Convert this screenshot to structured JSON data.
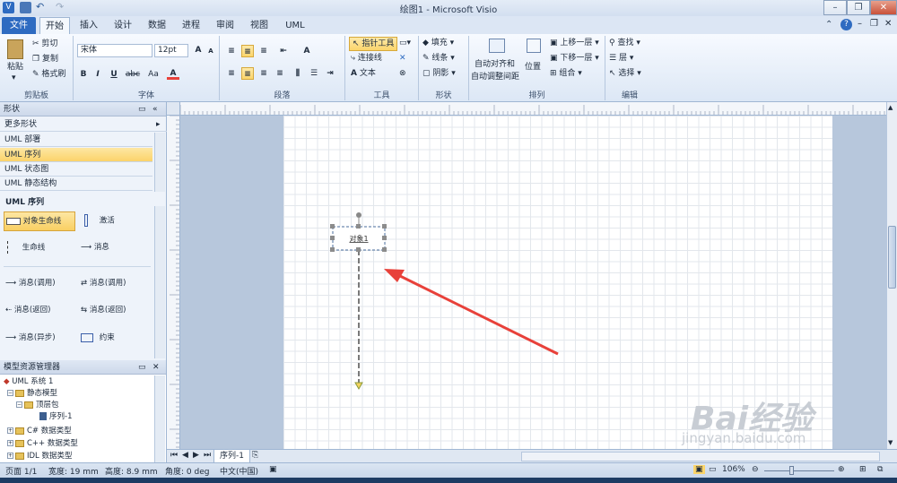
{
  "window": {
    "title": "绘图1 - Microsoft Visio"
  },
  "ribbon_tabs": [
    "文件",
    "开始",
    "插入",
    "设计",
    "数据",
    "进程",
    "审阅",
    "视图",
    "UML"
  ],
  "clipboard": {
    "paste": "粘贴",
    "cut": "剪切",
    "copy": "复制",
    "format_painter": "格式刷",
    "label": "剪贴板"
  },
  "font": {
    "family": "宋体",
    "size": "12pt",
    "label": "字体",
    "bold": "B",
    "italic": "I",
    "underline": "U",
    "strike": "abc",
    "case": "Aa",
    "color": "A"
  },
  "paragraph": {
    "label": "段落"
  },
  "tools": {
    "pointer": "指针工具",
    "connector": "连接线",
    "text": "文本",
    "label": "工具"
  },
  "shape": {
    "fill": "填充",
    "line": "线条",
    "shadow": "阴影",
    "label": "形状"
  },
  "arrange": {
    "auto_align": "自动对齐和",
    "auto_space": "自动调整间距",
    "position": "位置",
    "bring_forward": "上移一层",
    "send_backward": "下移一层",
    "group": "组合",
    "label": "排列"
  },
  "edit": {
    "find": "查找",
    "layer": "层",
    "select": "选择",
    "label": "编辑"
  },
  "shapes_panel": {
    "title": "形状",
    "more_shapes": "更多形状",
    "stencils": [
      "UML 部署",
      "UML 序列",
      "UML 状态图",
      "UML 静态结构"
    ],
    "active_stencil": "UML 序列",
    "items": [
      {
        "label": "对象生命线"
      },
      {
        "label": "激活"
      },
      {
        "label": "生命线"
      },
      {
        "label": "消息"
      },
      {
        "label": "消息(调用)"
      },
      {
        "label": "消息(调用)"
      },
      {
        "label": "消息(返回)"
      },
      {
        "label": "消息(返回)"
      },
      {
        "label": "消息(异步)"
      },
      {
        "label": "约束"
      }
    ]
  },
  "explorer": {
    "title": "模型资源管理器",
    "nodes": [
      "UML 系统 1",
      "静态模型",
      "顶层包",
      "序列-1",
      "C# 数据类型",
      "C++ 数据类型",
      "IDL 数据类型"
    ]
  },
  "canvas": {
    "object_label": "对象1"
  },
  "sheet_tab": "序列-1",
  "status": {
    "page": "页面 1/1",
    "width": "宽度: 19 mm",
    "height": "高度: 8.9 mm",
    "angle": "角度: 0 deg",
    "language": "中文(中国)",
    "zoom": "106%"
  },
  "watermark": {
    "main": "Bai经验",
    "sub": "jingyan.baidu.com"
  },
  "colors": {
    "accent": "#2e6bc1",
    "highlight": "#fbd56b",
    "arrow": "#e8413a"
  }
}
